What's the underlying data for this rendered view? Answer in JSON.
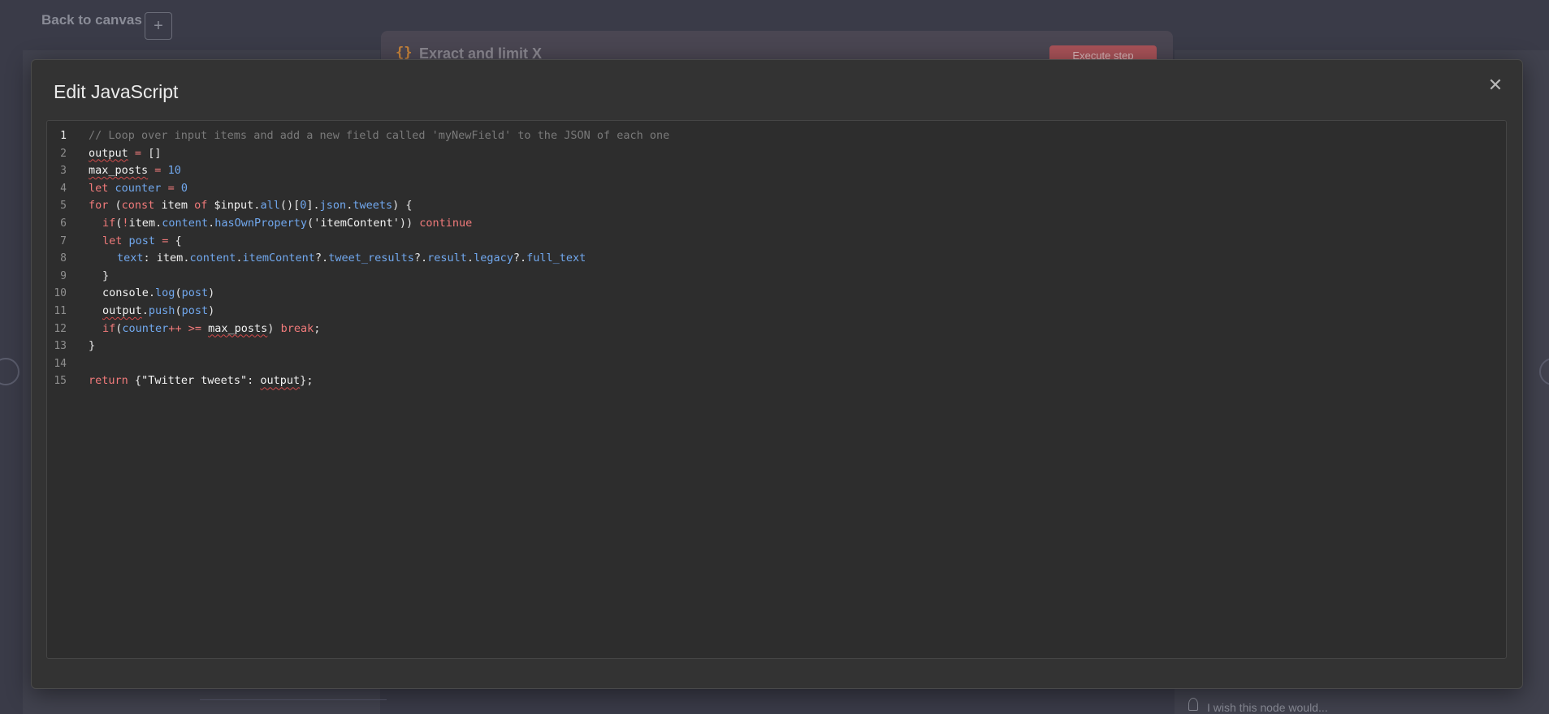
{
  "background": {
    "back_label": "Back to canvas",
    "plus_label": "+",
    "node_title": "Exract and limit X",
    "node_icon": "{}",
    "execute_label": "Execute step",
    "wish_label": "I wish this node would..."
  },
  "modal": {
    "title": "Edit JavaScript",
    "close_label": "✕"
  },
  "editor": {
    "active_line": 1,
    "line_numbers": [
      "1",
      "2",
      "3",
      "4",
      "5",
      "6",
      "7",
      "8",
      "9",
      "10",
      "11",
      "12",
      "13",
      "14",
      "15"
    ],
    "lines": [
      "// Loop over input items and add a new field called 'myNewField' to the JSON of each one",
      "output = []",
      "max_posts = 10",
      "let counter = 0",
      "for (const item of $input.all()[0].json.tweets) {",
      "  if(!item.content.hasOwnProperty('itemContent')) continue",
      "  let post = {",
      "    text: item.content.itemContent?.tweet_results?.result.legacy?.full_text",
      "  }",
      "  console.log(post)",
      "  output.push(post)",
      "  if(counter++ >= max_posts) break;",
      "}",
      "",
      "return {\"Twitter tweets\": output};"
    ]
  },
  "colors": {
    "modal_bg": "#333333",
    "editor_bg": "#2d2d2d",
    "keyword": "#f07a7a",
    "property": "#71a8ee",
    "comment": "#7a7a7a"
  }
}
